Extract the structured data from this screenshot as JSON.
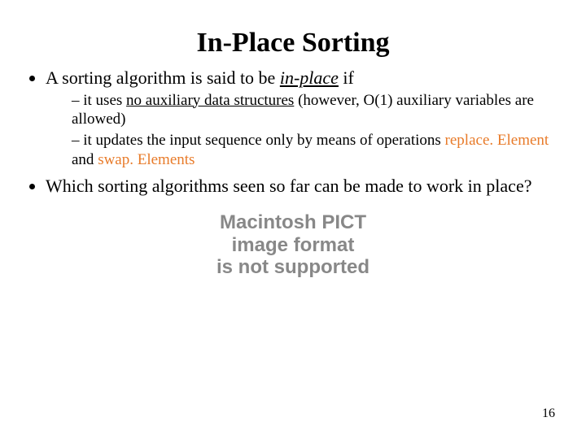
{
  "title": "In-Place Sorting",
  "bullets": {
    "b1_pre": "A sorting algorithm is said to be ",
    "b1_em": "in-place",
    "b1_post": " if",
    "sub1_pre": " it uses ",
    "sub1_u": "no auxiliary data structures",
    "sub1_post": " (however, O(1) auxiliary variables are allowed)",
    "sub2_pre": "it updates the input sequence only by means of operations ",
    "sub2_op1": "replace. Element",
    "sub2_mid": " and ",
    "sub2_op2": "swap. Elements",
    "b2": "Which sorting algorithms seen so far can be made to work in place?"
  },
  "pict": {
    "line1": "Macintosh PICT",
    "line2": "image format",
    "line3": "is not supported"
  },
  "page_number": "16"
}
